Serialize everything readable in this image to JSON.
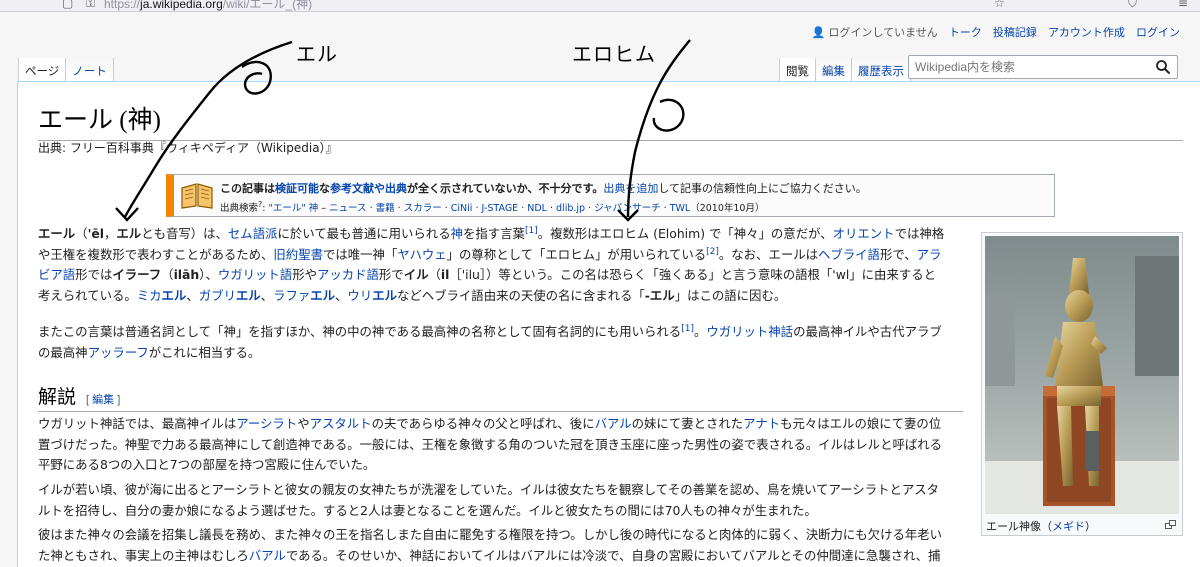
{
  "browser": {
    "url_prefix": "https://",
    "url_host": "ja.wikipedia.org",
    "url_path": "/wiki/エール_(神)"
  },
  "personal": {
    "user_status": "ログインしていません",
    "talk": "トーク",
    "contributions": "投稿記録",
    "create_account": "アカウント作成",
    "login": "ログイン"
  },
  "tabs": {
    "page": "ページ",
    "talk": "ノート",
    "read": "閲覧",
    "edit": "編集",
    "history": "履歴表示"
  },
  "search": {
    "placeholder": "Wikipedia内を検索"
  },
  "article": {
    "title": "エール (神)",
    "subtitle": "出典: フリー百科事典『ウィキペディア（Wikipedia）』",
    "ambox": {
      "pre": "この記事は",
      "link1": "検証可能",
      "mid1": "な",
      "link2": "参考文献や出典",
      "mid2": "が全く示されていないか、不十分です。",
      "link3": "出典を追加",
      "post": "して記事の信頼性向上にご協力ください。",
      "search_label": "出典検索",
      "search_sup": "?",
      "search_term": "\"エール\" 神",
      "sources": [
        "ニュース",
        "書籍",
        "スカラー",
        "CiNii",
        "J-STAGE",
        "NDL",
        "dlib.jp",
        "ジャパンサーチ",
        "TWL"
      ],
      "date": "（2010年10月）"
    },
    "section_heading": "解説",
    "section_edit": "編集"
  },
  "annotations": {
    "left": "エル",
    "right": "エロヒム"
  },
  "thumb": {
    "caption": "エール神像（",
    "caption_link": "メギド",
    "caption_end": "）"
  }
}
